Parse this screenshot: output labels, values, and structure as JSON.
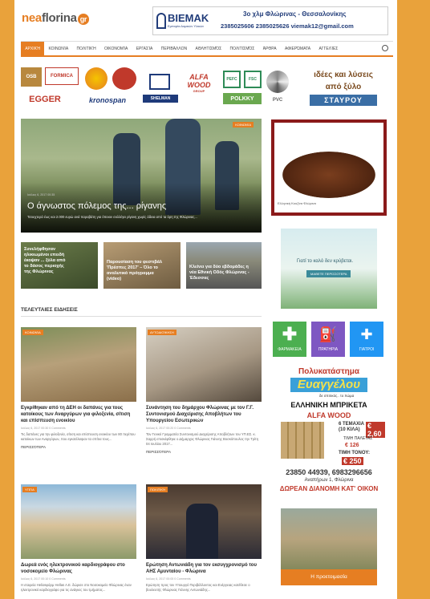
{
  "site": {
    "name_a": "nea",
    "name_b": "florina",
    "tld": "gr"
  },
  "topad": {
    "brand": "BIEMAK",
    "brand_sub": "Εμπορία Δομικών Υλικών",
    "line1": "3ο χλμ Φλώρινας - Θεσσαλονίκης",
    "line2": "2385025606  2385025626  viemak12@gmail.com"
  },
  "nav": [
    "Αρχική",
    "Κοινωνία",
    "Πολιτική",
    "Οικονομία",
    "Εργασία",
    "Περιβάλλον",
    "Αθλητισμός",
    "Πολιτισμός",
    "Άρθρα",
    "Αφιερώματα",
    "Αγγελίες"
  ],
  "logos": {
    "osb": "OSB",
    "formica": "FORMICA",
    "egger": "EGGER",
    "kronospan": "kronospan",
    "shelman": "SHELMAN",
    "alfawood": "ALFA WOOD",
    "alfawood_sub": "GROUP",
    "pefc": "PEFC",
    "fsc": "FSC",
    "polkky": "POLKKY",
    "pvc": "PVC",
    "slogan1": "ιδέες και λύσεις",
    "slogan2": "από ξύλο",
    "slogan3": "ΣΤΑΥΡΟΥ"
  },
  "featured": {
    "badge": "Κοινωνία",
    "title": "Ο άγνωστος πόλεμος της... ρίγανης",
    "meta": "Ιούλιος 6, 2017 00:35",
    "excerpt": "Τσουχτερά έως και 2.000 ευρώ ανά παραβάτη για όποιον συλλέγει ρίγανη χωρίς άδεια από τα όρη της Φλώρινας..."
  },
  "small": [
    {
      "title": "Συνελήφθησαν ηλικιωμένοι επειδή έκοψαν ... ξύλα από το δάσος περιοχής της Φλώρινας"
    },
    {
      "title": "Παρουσίαση του φεστιβάλ 'Πρέσπες 2017' – Όλο το αναλυτικό πρόγραμμα (video)"
    },
    {
      "title": "Κλείνει για δύο εβδομάδες η νέα Εθνική Οδός Φλώρινας - Έδεσσας"
    }
  ],
  "latest_title": "ΤΕΛΕΥΤΑΙΕΣ ΕΙΔΗΣΕΙΣ",
  "posts": [
    {
      "badge": "Κοινωνία",
      "title": "Εγκρίθηκαν από τη ΔΕΗ οι δαπάνες για τους κατοίκους των Αναργύρων για φιλοξενία, σίτιση και επίσπευση ενοικίου",
      "meta": "Ιούλιος 6, 2017 00:30  0 Comments",
      "excerpt": "Τις δαπάνες για την φιλοξενία, σίτιση και επίσπευση ενοικίου των 80 περίπου κατοίκων των Αναργύρων, που εγκατέλειψαν τα σπίτια τους...",
      "more": "Περισσότερα"
    },
    {
      "badge": "Αυτοδιοίκηση",
      "title": "Συνάντηση του δημάρχου Φλώρινας με τον Γ.Γ. Συντονισμού Διαχείρισης Αποβλήτων του Υπουργείου Εσωτερικών",
      "meta": "Ιούλιος 6, 2017 00:20  0 Comments",
      "excerpt": "Τον Γενικό Γραμματέα Συντονισμού Διαχείρισης Αποβλήτων του ΥΠ.ΕΣ. κ. Σαρρή επισκέφθηκε ο Δήμαρχος Φλώρινας Γιάννης Βοσκόπουλος την Τρίτη 04 Ιουλίου 2017...",
      "more": "Περισσότερα"
    },
    {
      "badge": "Υγεία",
      "title": "Δωρεά ενός ηλεκτρονικού καρδιογράφου στο νοσοκομείο Φλώρινας",
      "meta": "Ιούλιος 6, 2017 00:10  0 Comments",
      "excerpt": "Η εταιρεία Heliosφάρμ Hellas A.E. δώρισε στο Νοσοκομείο Φλώρινας έναν ηλεκτρονικό καρδιογράφο για τις ανάγκες του τμήματος...",
      "more": ""
    },
    {
      "badge": "Πολιτική",
      "title": "Ερώτηση Αντωνιάδη για τον εκσυγχρονισμό του ΑΗΣ Αμυνταίου - Φλώρινα",
      "meta": "Ιούλιος 6, 2017 00:05  0 Comments",
      "excerpt": "Ερώτηση προς τον Υπουργό Περιβάλλοντος και Ενέργειας κατέθεσε ο βουλευτής Φλώρινας Γιάννης Αντωνιάδης...",
      "more": ""
    }
  ],
  "side": {
    "food_caption": "Ελληνική Κουζίνα Φλώρινα",
    "spa_text": "Γιατί το καλό δεν κρύβεται.",
    "spa_btn": "ΜΑΘΕΤΕ ΠΕΡΙΣΣΟΤΕΡΑ",
    "icons": [
      "ΦΑΡΜΑΚΕΙΑ",
      "ΠΡΑΤΗΡΙΑ",
      "ΓΙΑΤΡΟΙ"
    ],
    "store1": "Πολυκατάστημα",
    "store2": "Ευαγγέλου",
    "store3": "δε σπιτικός.. το Χώμα",
    "brik1": "ΕΛΛΗΝΙΚΗ ΜΠΡΙΚΕΤΑ",
    "brik2": "ALFA WOOD",
    "brik3": "6 ΤΕΜΑΧΙΑ",
    "brik4": "(10 ΚΙΛΑ)",
    "brik5": "€ 2,60",
    "brik6": "ΤΙΜΗ ΠΑΛΕΤΑΣ",
    "brik7": "€ 126",
    "brik8": "ΤΙΜΗ ΤΟΝΟΥ:",
    "brik9": "€ 250",
    "phones": "23850 44939, 6983296656",
    "address": "Αναπήρων 1, Φλώρινα",
    "delivery": "ΔΩΡΕΑΝ ΔΙΑΝΟΜΗ ΚΑΤ' ΟΙΚΟΝ",
    "road_caption": "Η προετοιμασία"
  }
}
